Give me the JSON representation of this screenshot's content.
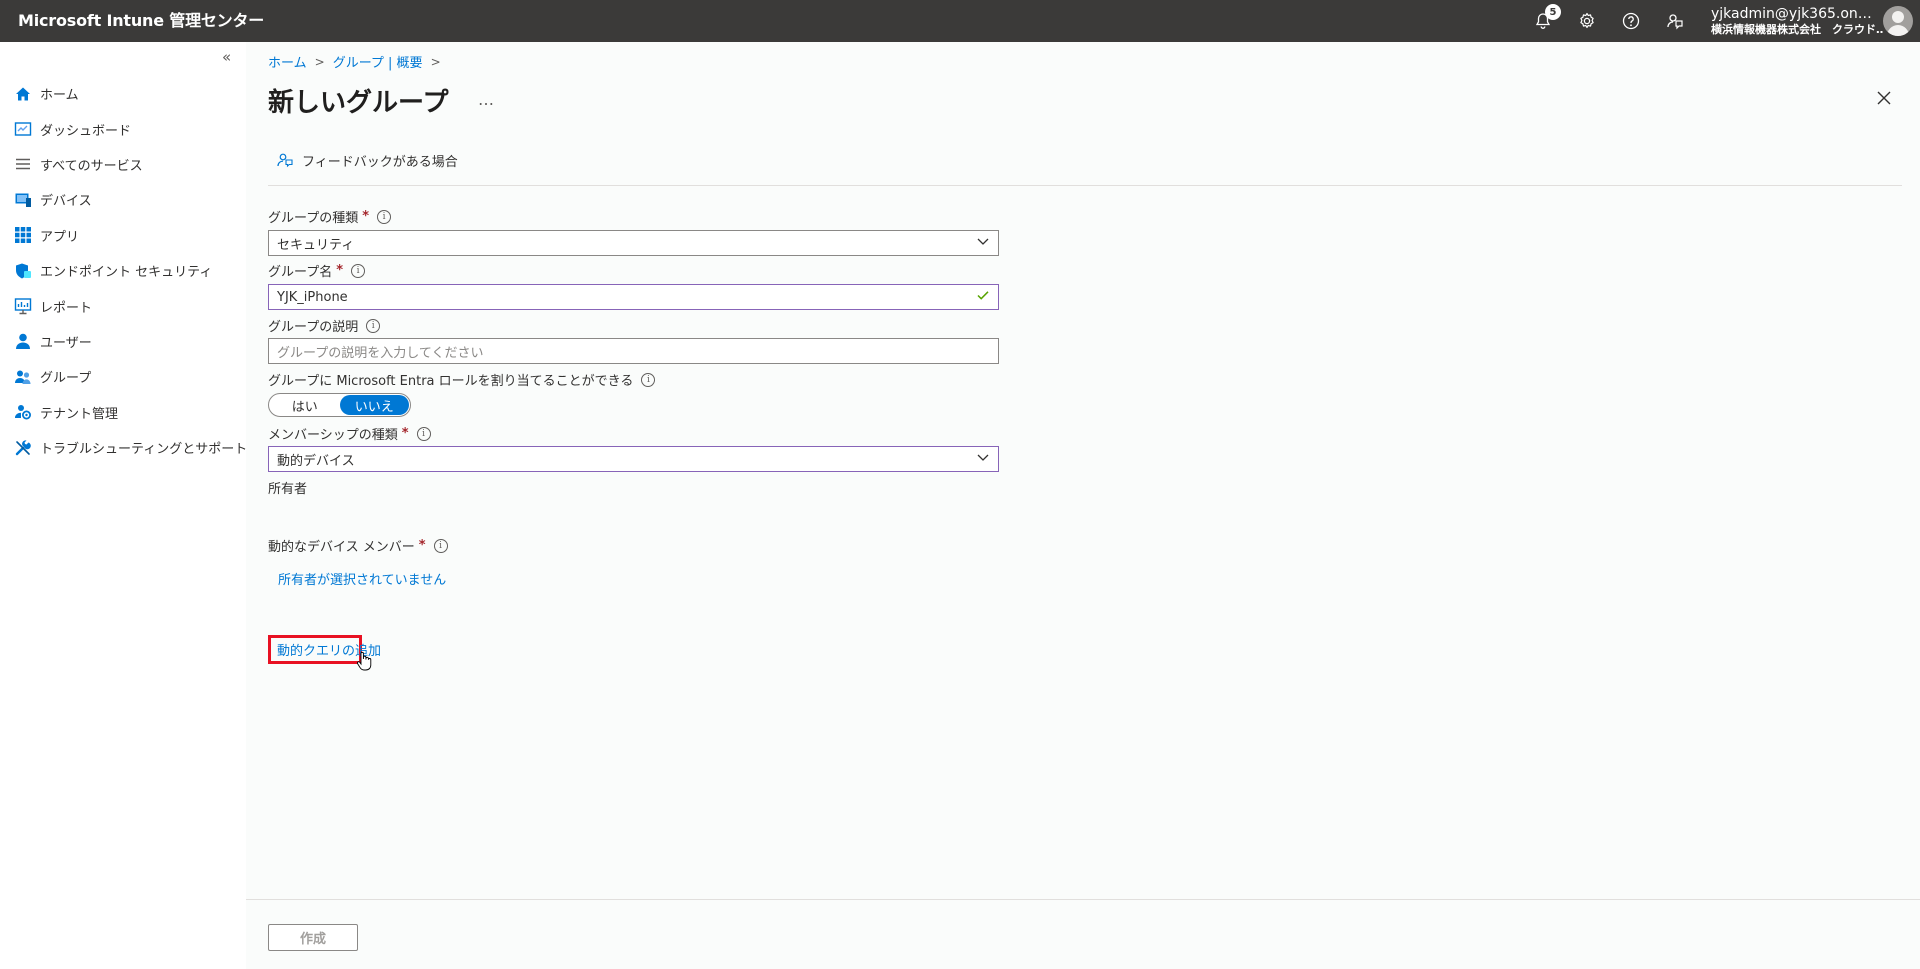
{
  "app": {
    "title": "Microsoft Intune 管理センター"
  },
  "topbar": {
    "notification_count": "5",
    "account_name": "yjkadmin@yjk365.on…",
    "account_org": "横浜情報機器株式会社　クラウド…",
    "icons": [
      "bell-icon",
      "gear-icon",
      "help-icon",
      "feedback-icon"
    ]
  },
  "sidebar": {
    "collapse_glyph": "«",
    "items": [
      {
        "label": "ホーム",
        "icon": "home-icon"
      },
      {
        "label": "ダッシュボード",
        "icon": "dashboard-icon"
      },
      {
        "label": "すべてのサービス",
        "icon": "list-icon"
      },
      {
        "label": "デバイス",
        "icon": "device-icon"
      },
      {
        "label": "アプリ",
        "icon": "apps-grid-icon"
      },
      {
        "label": "エンドポイント セキュリティ",
        "icon": "shield-icon"
      },
      {
        "label": "レポート",
        "icon": "report-icon"
      },
      {
        "label": "ユーザー",
        "icon": "user-icon"
      },
      {
        "label": "グループ",
        "icon": "group-icon"
      },
      {
        "label": "テナント管理",
        "icon": "tenant-admin-icon"
      },
      {
        "label": "トラブルシューティングとサポート",
        "icon": "wrench-icon"
      }
    ]
  },
  "breadcrumb": {
    "home": "ホーム",
    "groups": "グループ | 概要",
    "sep": ">"
  },
  "page": {
    "title": "新しいグループ",
    "more": "…",
    "feedback_label": "フィードバックがある場合"
  },
  "form": {
    "group_type": {
      "label": "グループの種類",
      "value": "セキュリティ"
    },
    "group_name": {
      "label": "グループ名",
      "value": "YJK_iPhone"
    },
    "group_description": {
      "label": "グループの説明",
      "placeholder": "グループの説明を入力してください"
    },
    "entra_role": {
      "label": "グループに Microsoft Entra ロールを割り当てることができる",
      "yes": "はい",
      "no": "いいえ",
      "selected": "いいえ"
    },
    "membership_type": {
      "label": "メンバーシップの種類",
      "value": "動的デバイス"
    },
    "owners": {
      "label": "所有者",
      "link": "所有者が選択されていません"
    },
    "dynamic_members": {
      "label": "動的なデバイス メンバー",
      "link": "動的クエリの追加"
    },
    "required_marker": "*",
    "info_glyph": "i"
  },
  "footer": {
    "create_label": "作成"
  },
  "colors": {
    "topbar": "#3b3a39",
    "accent": "#0078d4",
    "highlight": "#e81123",
    "required": "#a4262c",
    "active_border": "#8764b8"
  }
}
